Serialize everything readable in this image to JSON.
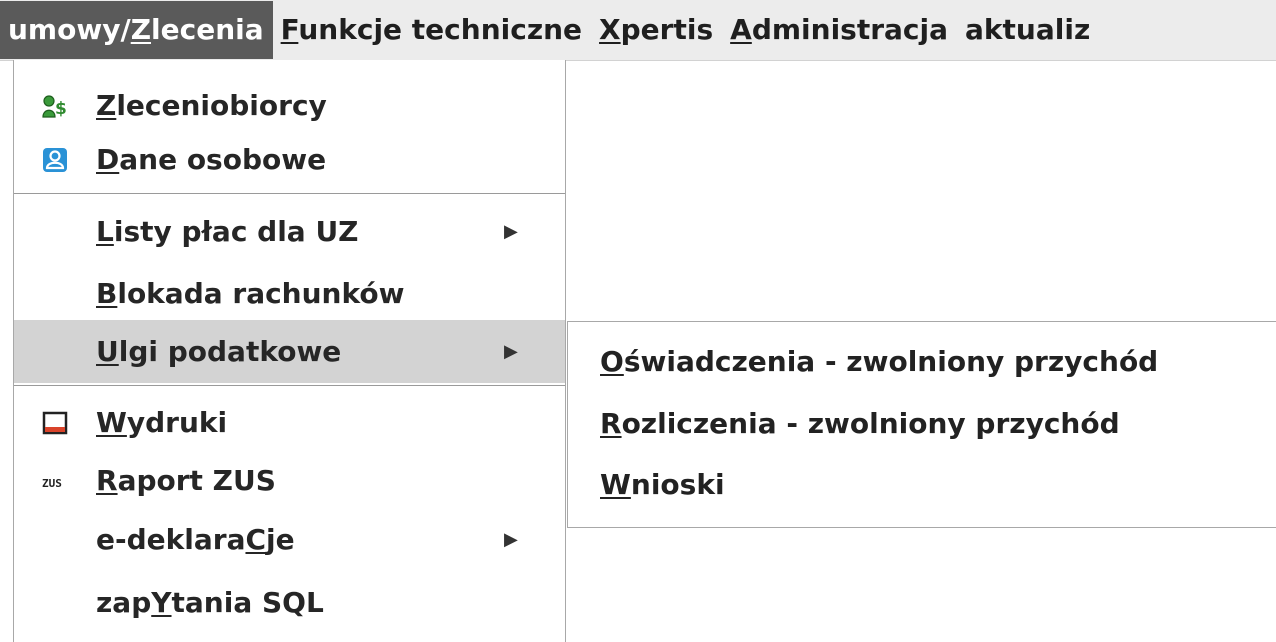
{
  "menubar": {
    "items": [
      {
        "pre": "umowy/",
        "key": "Z",
        "post": "lecenia"
      },
      {
        "pre": "",
        "key": "F",
        "post": "unkcje techniczne"
      },
      {
        "pre": "",
        "key": "X",
        "post": "pertis"
      },
      {
        "pre": "",
        "key": "A",
        "post": "dministracja"
      },
      {
        "pre": "aktualiz",
        "key": "",
        "post": ""
      }
    ]
  },
  "main_menu": {
    "items": [
      {
        "pre": "",
        "key": "Z",
        "post": "leceniobiorcy",
        "icon": "users-money-icon"
      },
      {
        "pre": "",
        "key": "D",
        "post": "ane osobowe",
        "icon": "person-card-icon"
      },
      {
        "pre": "",
        "key": "L",
        "post": "isty płac dla UZ",
        "arrow": "▶"
      },
      {
        "pre": "",
        "key": "B",
        "post": "lokada rachunków"
      },
      {
        "pre": "",
        "key": "U",
        "post": "lgi podatkowe",
        "arrow": "▶"
      },
      {
        "pre": "",
        "key": "W",
        "post": "ydruki",
        "icon": "printer-doc-icon"
      },
      {
        "pre": "",
        "key": "R",
        "post": "aport ZUS",
        "icon": "zus-icon",
        "icon_text": "ZUS"
      },
      {
        "pre": "e-deklara",
        "key": "C",
        "post": "je",
        "arrow": "▶"
      },
      {
        "pre": "zap",
        "key": "Y",
        "post": "tania SQL"
      }
    ]
  },
  "sub_menu": {
    "items": [
      {
        "pre": "",
        "key": "O",
        "post": "świadczenia - zwolniony przychód"
      },
      {
        "pre": "",
        "key": "R",
        "post": "ozliczenia - zwolniony przychód"
      },
      {
        "pre": "",
        "key": "W",
        "post": "nioski"
      }
    ]
  }
}
